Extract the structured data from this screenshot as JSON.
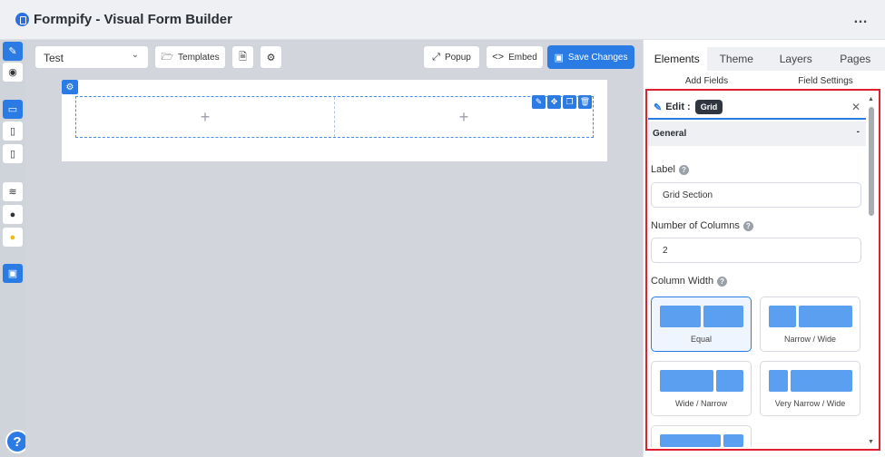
{
  "app": {
    "title": "Formpify - Visual Form Builder",
    "menu_glyph": "…"
  },
  "toolbar": {
    "form_select": "Test",
    "templates_label": "Templates",
    "popup_label": "Popup",
    "embed_label": "Embed",
    "save_label": "Save Changes"
  },
  "canvas": {
    "col1_glyph": "+",
    "col2_glyph": "+"
  },
  "panel": {
    "tabs": [
      "Elements",
      "Theme",
      "Layers",
      "Pages"
    ],
    "subtabs": [
      "Add Fields",
      "Field Settings"
    ],
    "edit_title": "Edit :",
    "edit_chip": "Grid",
    "section_title": "General",
    "section_toggle": "-",
    "label_caption": "Label",
    "label_value": "Grid Section",
    "columns_caption": "Number of Columns",
    "columns_value": "2",
    "width_caption": "Column Width",
    "width_options": [
      "Equal",
      "Narrow / Wide",
      "Wide / Narrow",
      "Very Narrow / Wide"
    ],
    "selected_width": "Equal"
  },
  "colors": {
    "accent": "#2b7be5",
    "highlight": "#e02030"
  },
  "icons": [
    "edit-icon",
    "eye-icon",
    "desktop-icon",
    "tablet-icon",
    "mobile-icon",
    "layers-icon",
    "help-icon",
    "bulb-icon",
    "save-icon",
    "folder-icon",
    "file-icon",
    "settings-icon",
    "expand-icon",
    "code-icon",
    "close-icon",
    "move-icon",
    "copy-icon",
    "trash-icon"
  ]
}
